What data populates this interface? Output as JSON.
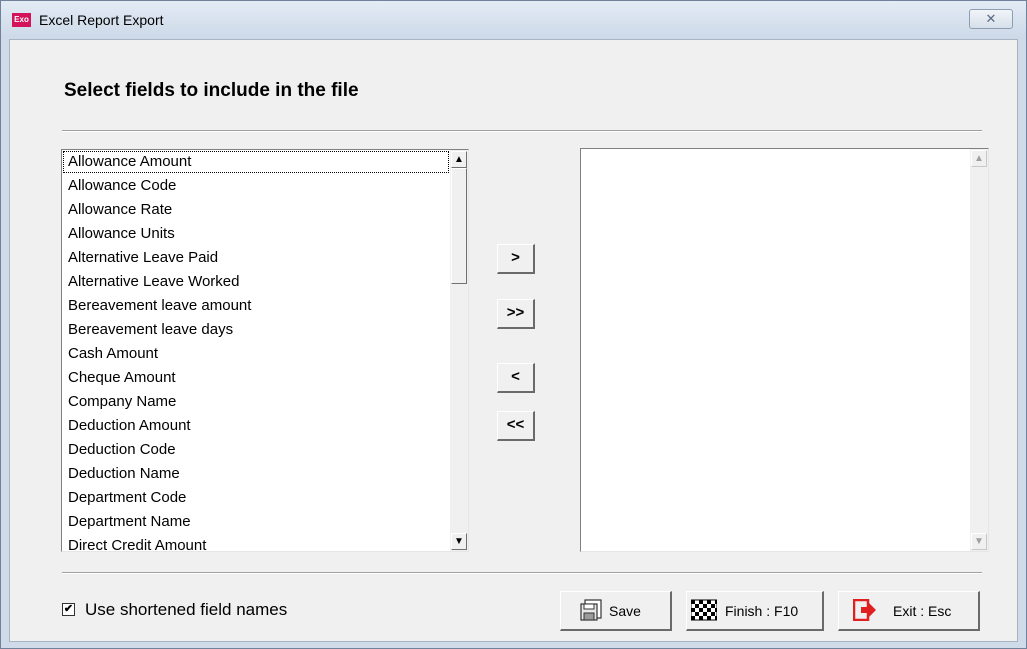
{
  "window": {
    "title": "Excel Report Export",
    "app_icon_text": "Exo",
    "close_glyph": "✕"
  },
  "dialog": {
    "heading": "Select fields to include in the file"
  },
  "available_fields": [
    "Allowance Amount",
    "Allowance Code",
    "Allowance Rate",
    "Allowance Units",
    "Alternative Leave Paid",
    "Alternative Leave Worked",
    "Bereavement leave amount",
    "Bereavement leave days",
    "Cash Amount",
    "Cheque Amount",
    "Company Name",
    "Deduction Amount",
    "Deduction Code",
    "Deduction Name",
    "Department Code",
    "Department Name",
    "Direct Credit Amount"
  ],
  "selected_fields": [],
  "transfer_buttons": {
    "add": ">",
    "add_all": ">>",
    "remove": "<",
    "remove_all": "<<"
  },
  "options": {
    "shortened_names_label": "Use shortened field names",
    "shortened_names_checked": true,
    "check_glyph": "✔"
  },
  "actions": {
    "save": "Save",
    "finish": "Finish : F10",
    "exit": "Exit : Esc"
  },
  "icons": {
    "save": "floppy-disk-icon",
    "finish": "checkered-flag-icon",
    "exit": "exit-arrow-icon"
  },
  "colors": {
    "exit_icon": "#e02020",
    "app_icon": "#d4145a"
  }
}
